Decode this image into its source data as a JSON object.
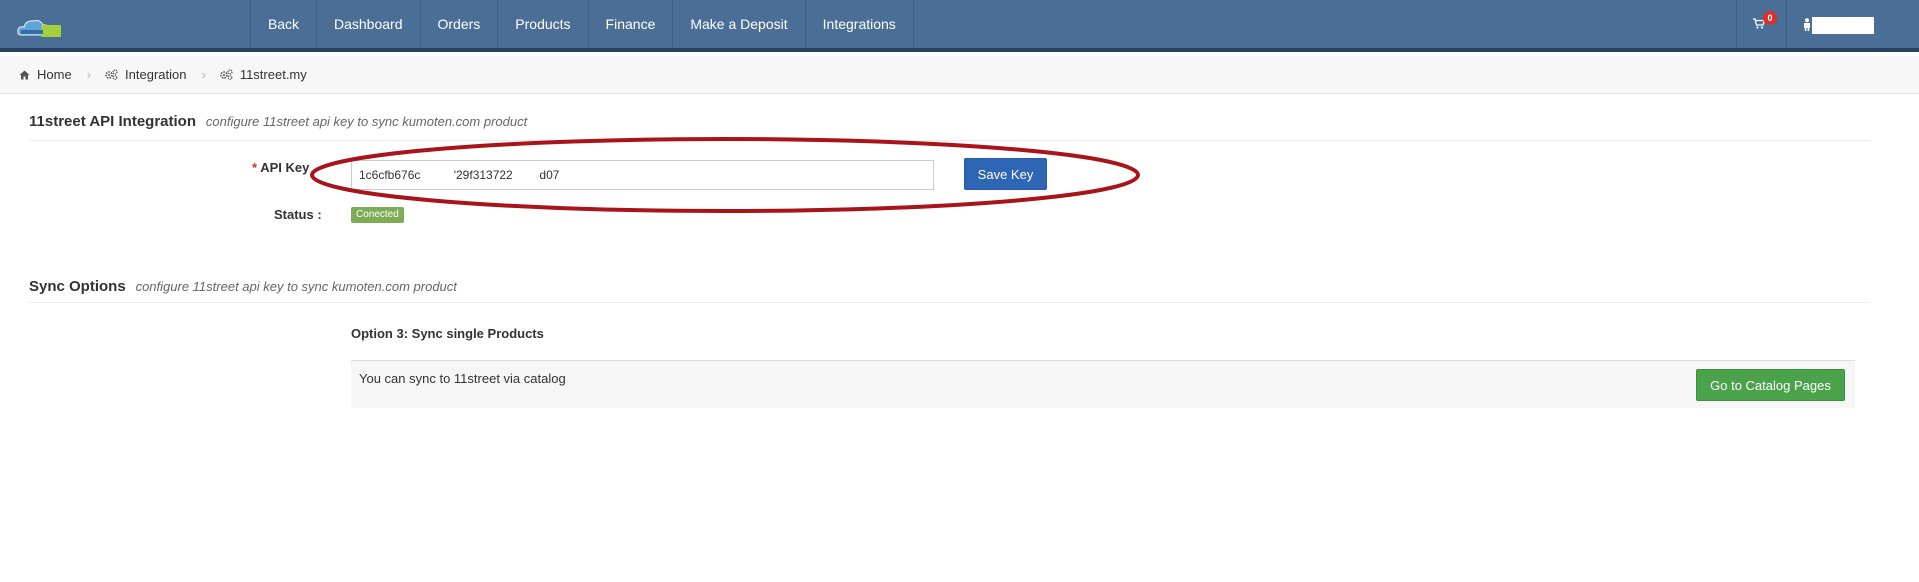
{
  "navbar": {
    "items": [
      "Back",
      "Dashboard",
      "Orders",
      "Products",
      "Finance",
      "Make a Deposit",
      "Integrations"
    ],
    "cart_count": "0",
    "colors": {
      "bar": "#4a6e95",
      "bar_border": "#2a4260"
    }
  },
  "breadcrumb": {
    "items": [
      {
        "icon": "home-icon",
        "label": "Home"
      },
      {
        "icon": "gears-icon",
        "label": "Integration"
      },
      {
        "icon": "gears-icon",
        "label": "11street.my"
      }
    ]
  },
  "api_section": {
    "title": "11street API Integration",
    "description": "configure 11street api key to sync kumoten.com product",
    "required_mark": "*",
    "api_key_label": "API Key",
    "api_key_value": "1c6cfb676c          '29f313722        d07",
    "save_label": "Save Key",
    "status_label": "Status :",
    "status_value": "Conected"
  },
  "sync_section": {
    "title": "Sync Options",
    "description": "configure 11street api key to sync kumoten.com product",
    "option_title": "Option 3: Sync single Products",
    "option_text": "You can sync to 11street via catalog",
    "catalog_button": "Go to Catalog Pages"
  }
}
